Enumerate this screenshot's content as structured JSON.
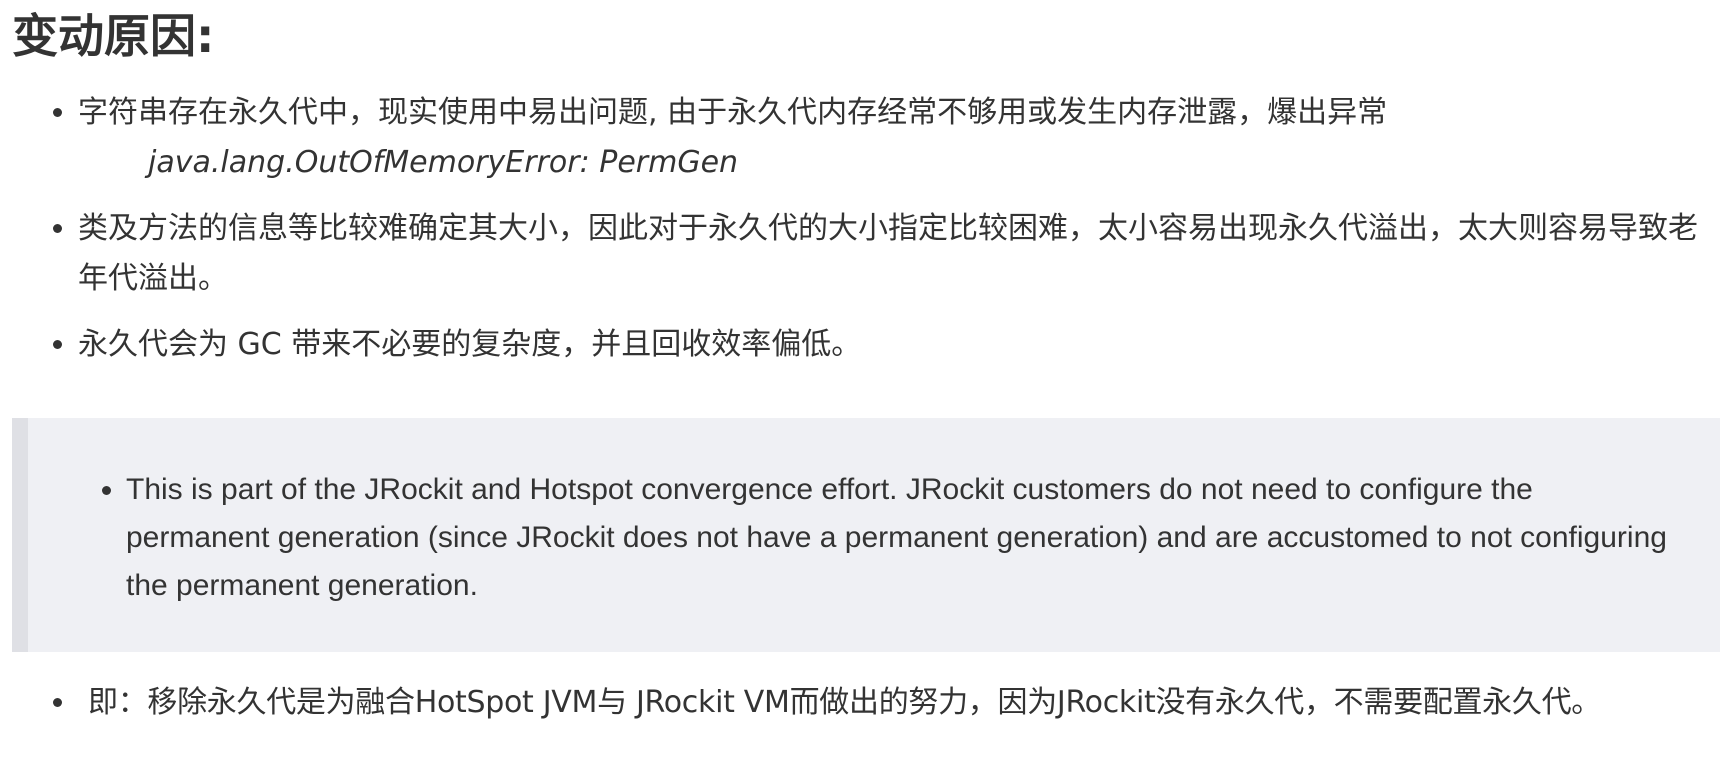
{
  "heading": "变动原因:",
  "reasons": [
    {
      "text": "字符串存在永久代中，现实使用中易出问题, 由于永久代内存经常不够用或发生内存泄露，爆出异常",
      "code": "java.lang.OutOfMemoryError: PermGen"
    },
    {
      "text": "类及方法的信息等比较难确定其大小，因此对于永久代的大小指定比较困难，太小容易出现永久代溢出，太大则容易导致老年代溢出。"
    },
    {
      "text": "永久代会为 GC 带来不必要的复杂度，并且回收效率偏低。"
    }
  ],
  "quote": {
    "items": [
      "This is part of the JRockit and Hotspot convergence effort. JRockit customers do not need to configure the permanent generation (since JRockit does not have a permanent generation) and are accustomed to not configuring the permanent generation."
    ]
  },
  "summary": "即：移除永久代是为融合HotSpot JVM与 JRockit VM而做出的努力，因为JRockit没有永久代，不需要配置永久代。"
}
